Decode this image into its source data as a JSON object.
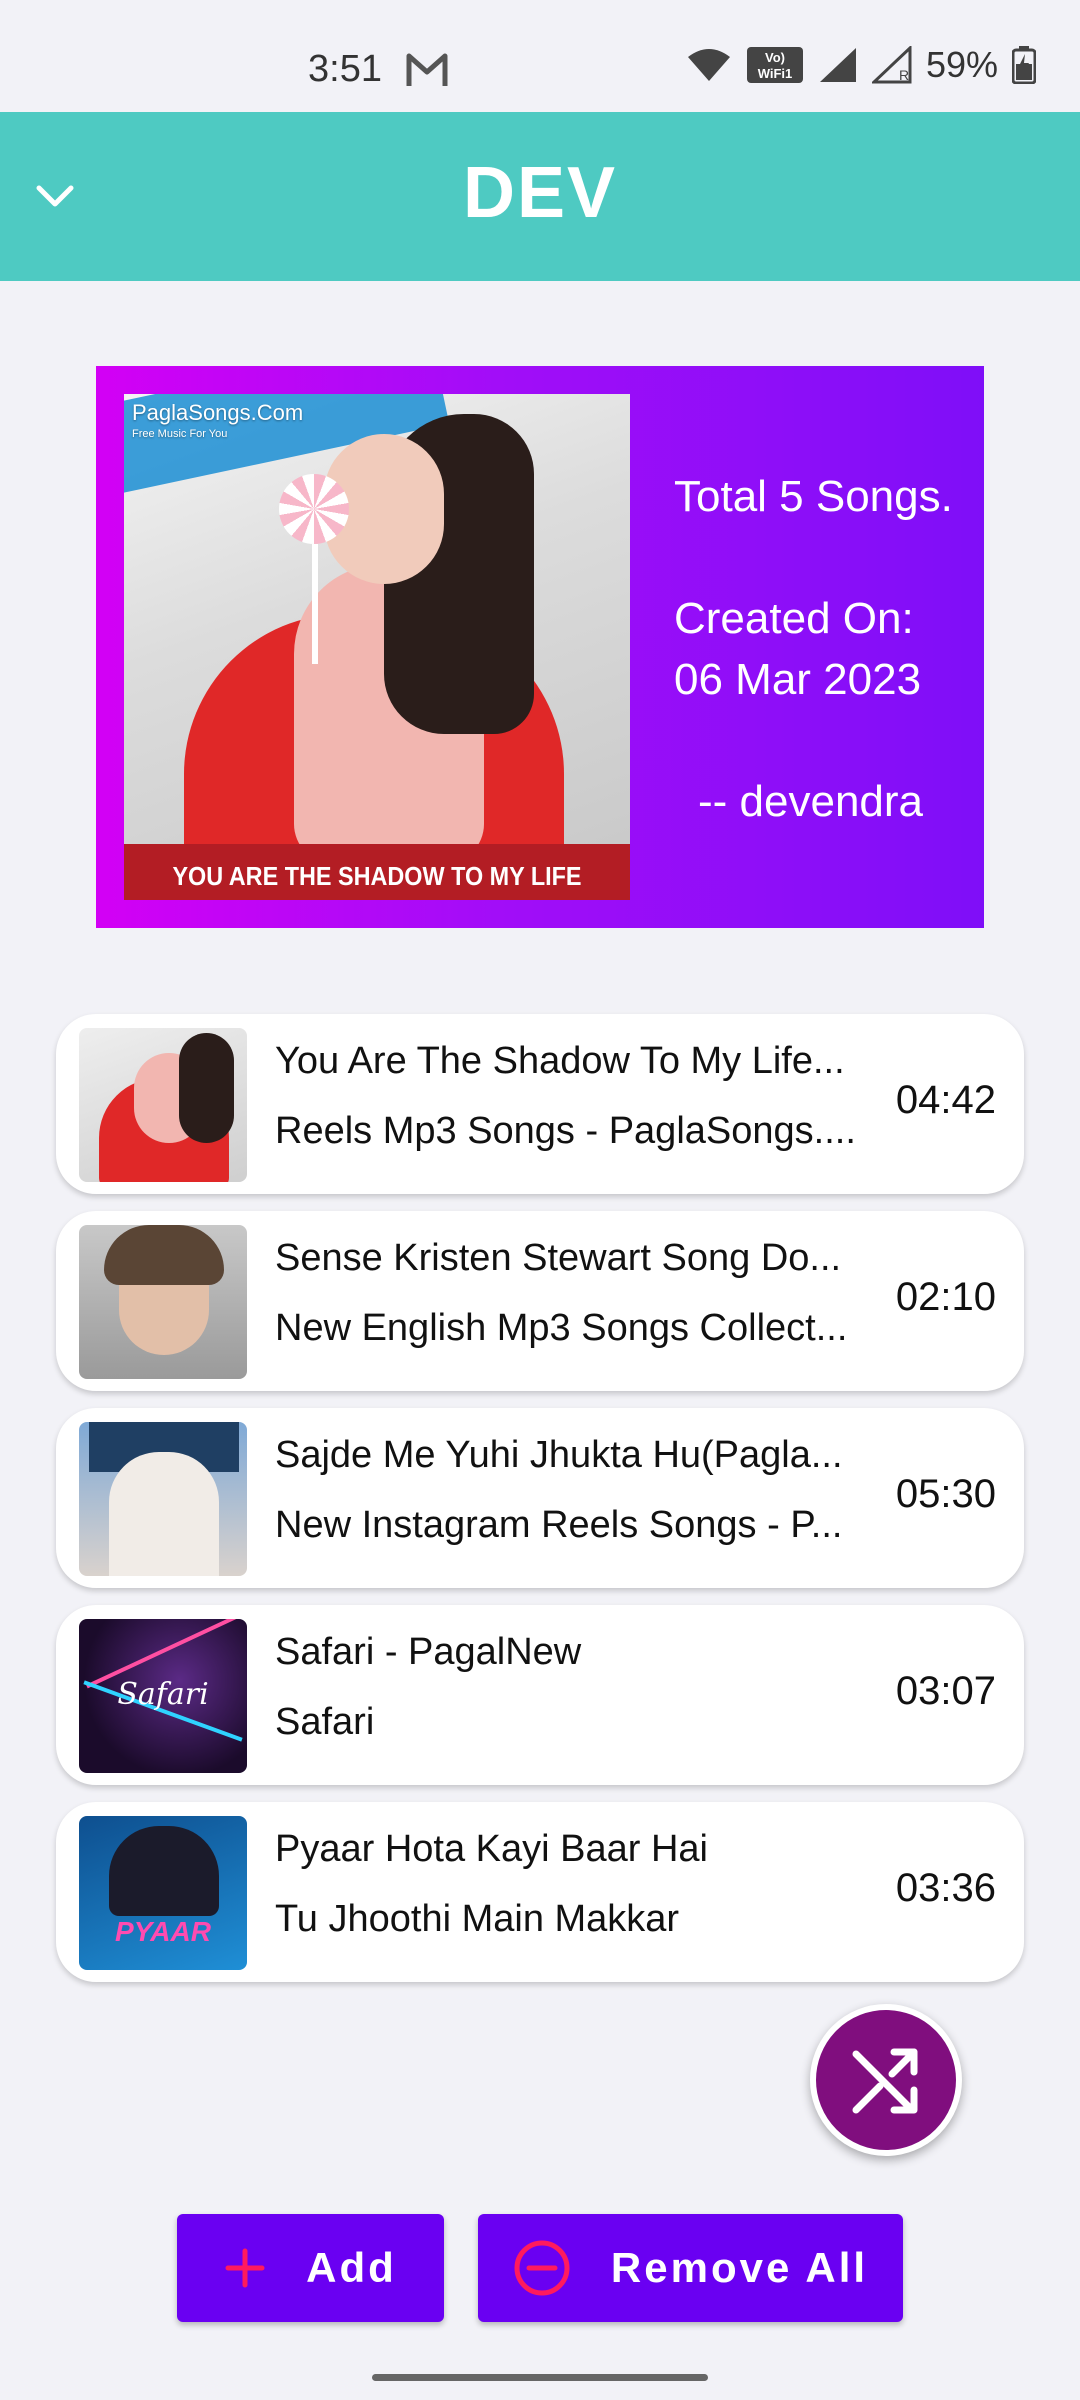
{
  "status_bar": {
    "time": "3:51",
    "battery": "59%",
    "volte": "Vo) WiFi 1"
  },
  "header": {
    "title": "DEV",
    "back_icon": "chevron-down-icon",
    "bg_color": "#4ecac2"
  },
  "playlist": {
    "cover_site": "PaglaSongs.Com",
    "cover_tagline": "Free Music For You",
    "cover_caption": "YOU ARE THE SHADOW TO MY LIFE",
    "total": "Total 5 Songs.",
    "created_label": "Created On:",
    "created_date": "06 Mar 2023",
    "author": "-- devendra"
  },
  "songs": [
    {
      "title": "You Are The Shadow To My Life...",
      "subtitle": "Reels Mp3 Songs - PaglaSongs....",
      "duration": "04:42"
    },
    {
      "title": "Sense Kristen Stewart Song Do...",
      "subtitle": "New English Mp3 Songs Collect...",
      "duration": "02:10"
    },
    {
      "title": "Sajde Me Yuhi Jhukta Hu(Pagla...",
      "subtitle": "New Instagram Reels Songs  - P...",
      "duration": "05:30"
    },
    {
      "title": "Safari - PagalNew",
      "subtitle": "Safari",
      "duration": "03:07"
    },
    {
      "title": "Pyaar Hota Kayi Baar Hai",
      "subtitle": "Tu Jhoothi Main Makkar",
      "duration": "03:36"
    }
  ],
  "thumb_text": {
    "safari": "Safari",
    "pyaar": "PYAAR"
  },
  "fab": {
    "icon": "shuffle-icon",
    "color": "#800e7e"
  },
  "actions": {
    "add_label": "Add",
    "remove_label": "Remove All",
    "color": "#6a00f2",
    "icon_color": "#ff1a5e"
  }
}
